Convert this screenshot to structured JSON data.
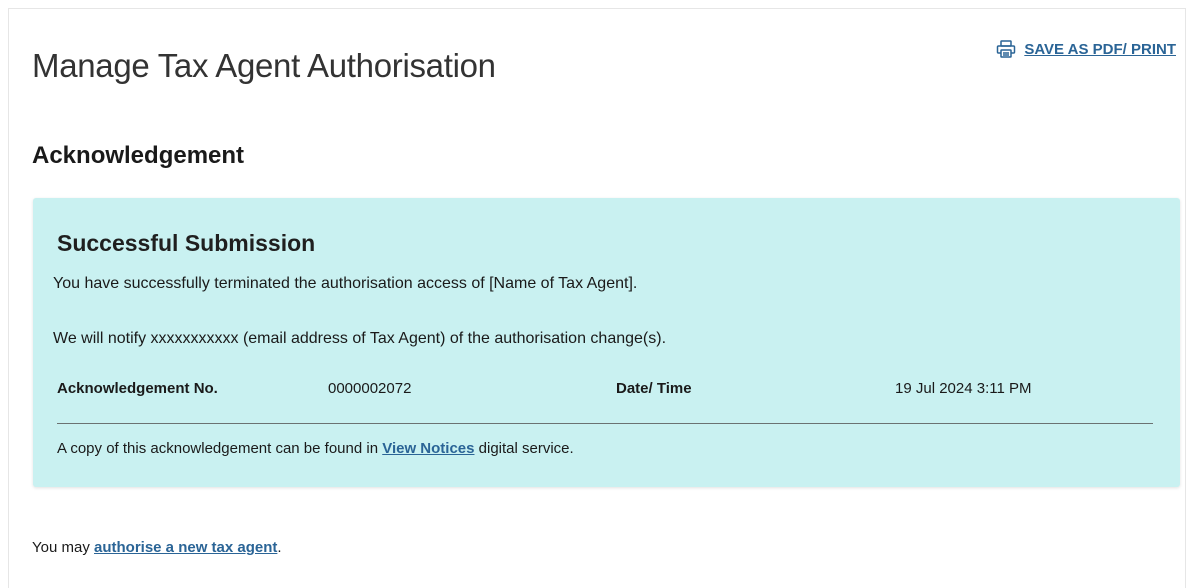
{
  "header": {
    "title": "Manage Tax Agent Authorisation",
    "print_label": "SAVE AS PDF/ PRINT",
    "print_icon": "printer-icon"
  },
  "section": {
    "heading": "Acknowledgement"
  },
  "ack": {
    "title": "Successful Submission",
    "message_1": "You have successfully terminated the authorisation access of [Name of Tax Agent].",
    "message_2": "We will notify xxxxxxxxxxx (email address of Tax Agent) of the authorisation change(s).",
    "ack_no_label": "Acknowledgement No.",
    "ack_no_value": "0000002072",
    "datetime_label": "Date/ Time",
    "datetime_value": "19 Jul 2024 3:11 PM",
    "copy_note_prefix": "A copy of this acknowledgement can be found in ",
    "copy_note_link": "View Notices",
    "copy_note_suffix": " digital service.",
    "background_color": "#c9f1f1"
  },
  "footer": {
    "prefix": "You may ",
    "link": "authorise a new tax agent",
    "suffix": "."
  },
  "colors": {
    "link": "#2a6496",
    "title_text": "#333333"
  }
}
